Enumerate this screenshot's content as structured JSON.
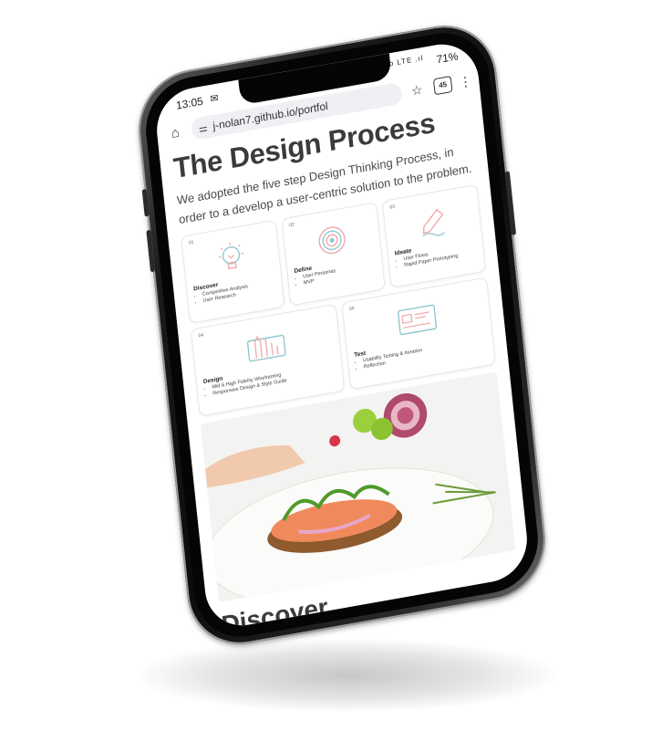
{
  "status_bar": {
    "time": "13:05",
    "network": "Vo LTE .ıl",
    "battery": "71%"
  },
  "browser": {
    "url": "j-nolan7.github.io/portfol",
    "tab_count": "45"
  },
  "page": {
    "title": "The Design Process",
    "intro": "We adopted the five step Design Thinking Process, in order to a develop a user-centric solution to the problem.",
    "section_title": "Discover"
  },
  "steps": [
    {
      "num": "01",
      "title": "Discover",
      "items": [
        "Competitive Analysis",
        "User Research"
      ]
    },
    {
      "num": "02",
      "title": "Define",
      "items": [
        "User Personas",
        "MVP"
      ]
    },
    {
      "num": "03",
      "title": "Ideate",
      "items": [
        "User Flows",
        "Rapid Paper Prototyping"
      ]
    },
    {
      "num": "04",
      "title": "Design",
      "items": [
        "Mid & High Fidelity Wireframing",
        "Responsive Design & Style Guide"
      ]
    },
    {
      "num": "05",
      "title": "Test",
      "items": [
        "Usability Testing & Iteration",
        "Reflection"
      ]
    }
  ],
  "colors": {
    "accent_pink": "#f0a7a7",
    "accent_teal": "#8fc7cf",
    "heading": "#3b3b3b"
  }
}
